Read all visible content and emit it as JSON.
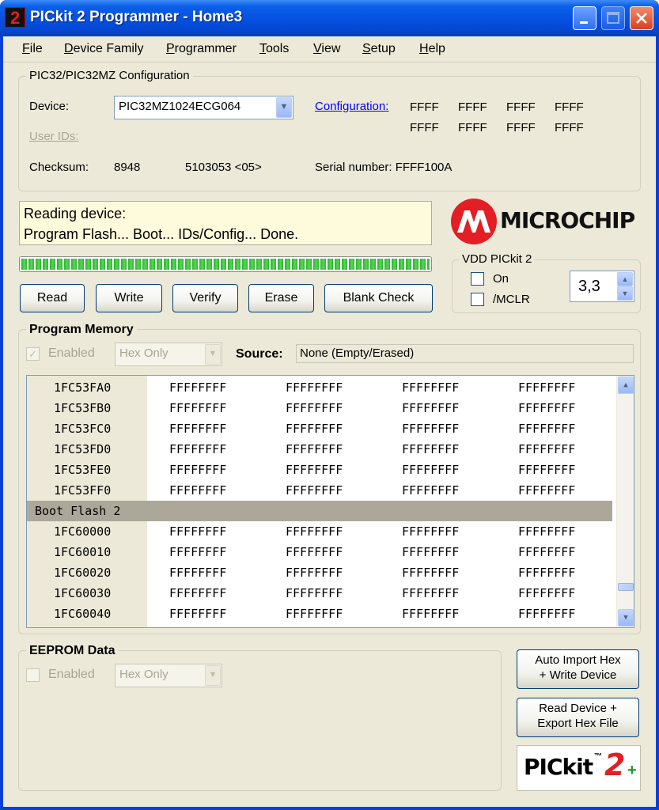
{
  "window": {
    "title": "PICkit 2 Programmer - Home3",
    "icon": "pickit2-app-icon"
  },
  "menu": [
    "File",
    "Device Family",
    "Programmer",
    "Tools",
    "View",
    "Setup",
    "Help"
  ],
  "config": {
    "group_label": "PIC32/PIC32MZ Configuration",
    "device_label": "Device:",
    "device_value": "PIC32MZ1024ECG064",
    "user_ids_label": "User IDs:",
    "configuration_label": "Configuration:",
    "config_words": [
      "FFFF",
      "FFFF",
      "FFFF",
      "FFFF",
      "FFFF",
      "FFFF",
      "FFFF",
      "FFFF"
    ],
    "checksum_label": "Checksum:",
    "checksum_value": "8948",
    "osccal_value": "5103053 <05>",
    "serial_label": "Serial number: FFFF100A"
  },
  "status": {
    "line1": "Reading device:",
    "line2": "Program Flash... Boot... IDs/Config... Done.",
    "progress": 1.0
  },
  "buttons": {
    "read": "Read",
    "write": "Write",
    "verify": "Verify",
    "erase": "Erase",
    "blank_check": "Blank Check"
  },
  "brand": {
    "text": "MICROCHIP",
    "color": "#e31e24"
  },
  "vdd": {
    "group_label": "VDD PICkit 2",
    "on_label": "On",
    "mclr_label": "/MCLR",
    "voltage": "3,3"
  },
  "program_memory": {
    "group_label": "Program Memory",
    "enabled_label": "Enabled",
    "format": "Hex Only",
    "source_label": "Source:",
    "source_value": "None (Empty/Erased)",
    "rows": [
      {
        "addr": "1FC53FA0",
        "cells": [
          "FFFFFFFF",
          "FFFFFFFF",
          "FFFFFFFF",
          "FFFFFFFF"
        ]
      },
      {
        "addr": "1FC53FB0",
        "cells": [
          "FFFFFFFF",
          "FFFFFFFF",
          "FFFFFFFF",
          "FFFFFFFF"
        ]
      },
      {
        "addr": "1FC53FC0",
        "cells": [
          "FFFFFFFF",
          "FFFFFFFF",
          "FFFFFFFF",
          "FFFFFFFF"
        ]
      },
      {
        "addr": "1FC53FD0",
        "cells": [
          "FFFFFFFF",
          "FFFFFFFF",
          "FFFFFFFF",
          "FFFFFFFF"
        ]
      },
      {
        "addr": "1FC53FE0",
        "cells": [
          "FFFFFFFF",
          "FFFFFFFF",
          "FFFFFFFF",
          "FFFFFFFF"
        ]
      },
      {
        "addr": "1FC53FF0",
        "cells": [
          "FFFFFFFF",
          "FFFFFFFF",
          "FFFFFFFF",
          "FFFFFFFF"
        ]
      },
      {
        "section": "Boot Flash 2"
      },
      {
        "addr": "1FC60000",
        "cells": [
          "FFFFFFFF",
          "FFFFFFFF",
          "FFFFFFFF",
          "FFFFFFFF"
        ]
      },
      {
        "addr": "1FC60010",
        "cells": [
          "FFFFFFFF",
          "FFFFFFFF",
          "FFFFFFFF",
          "FFFFFFFF"
        ]
      },
      {
        "addr": "1FC60020",
        "cells": [
          "FFFFFFFF",
          "FFFFFFFF",
          "FFFFFFFF",
          "FFFFFFFF"
        ]
      },
      {
        "addr": "1FC60030",
        "cells": [
          "FFFFFFFF",
          "FFFFFFFF",
          "FFFFFFFF",
          "FFFFFFFF"
        ]
      },
      {
        "addr": "1FC60040",
        "cells": [
          "FFFFFFFF",
          "FFFFFFFF",
          "FFFFFFFF",
          "FFFFFFFF"
        ]
      }
    ]
  },
  "eeprom": {
    "group_label": "EEPROM Data",
    "enabled_label": "Enabled",
    "format": "Hex Only"
  },
  "side_buttons": {
    "auto_import_1": "Auto Import Hex",
    "auto_import_2": "+ Write Device",
    "read_export_1": "Read Device +",
    "read_export_2": "Export Hex File"
  },
  "pickit_logo": {
    "text": "PICkit",
    "tm": "™",
    "two": "2",
    "plus": "+"
  }
}
